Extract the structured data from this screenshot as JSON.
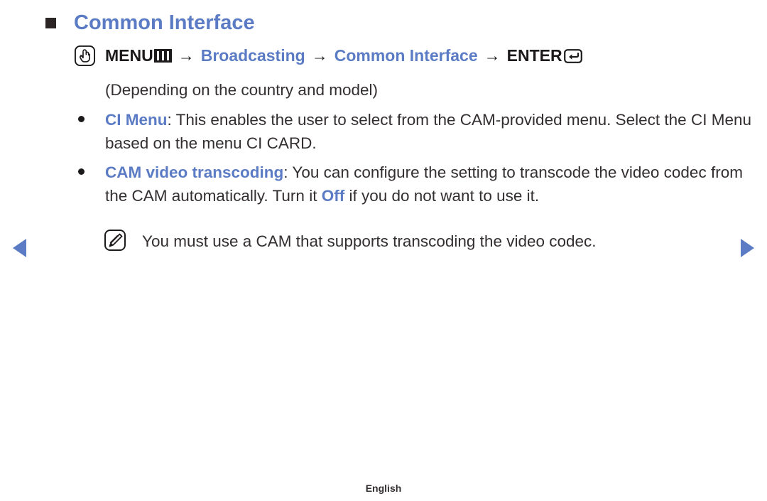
{
  "heading": {
    "bullet_icon": "square-bullet-icon",
    "title": "Common Interface",
    "color": "#5b7cc4"
  },
  "menu_path": {
    "press_icon": "press-hand-icon",
    "menu_label": "MENU",
    "menu_icon": "menu-bars-icon",
    "arrow1": "→",
    "broadcasting_label": "Broadcasting",
    "arrow2": "→",
    "common_interface_label": "Common Interface",
    "arrow3": "→",
    "enter_label": "ENTER",
    "enter_icon": "enter-return-icon"
  },
  "body": {
    "depending_note": "(Depending on the country and model)",
    "bullets": [
      {
        "highlight": "CI Menu",
        "text": ": This enables the user to select from the CAM-provided menu. Select the CI Menu based on the menu CI CARD."
      },
      {
        "highlight": "CAM video transcoding",
        "text_before": ": You can configure the setting to transcode the video codec from the CAM automatically. Turn it ",
        "inline_highlight": "Off",
        "text_after": " if you do not want to use it."
      }
    ],
    "note": {
      "icon": "note-pencil-icon",
      "text": "You must use a CAM that supports transcoding the video codec."
    }
  },
  "navigation": {
    "prev_icon": "previous-page-arrow-icon",
    "next_icon": "next-page-arrow-icon",
    "color": "#5b7cc4"
  },
  "footer": {
    "language": "English"
  }
}
